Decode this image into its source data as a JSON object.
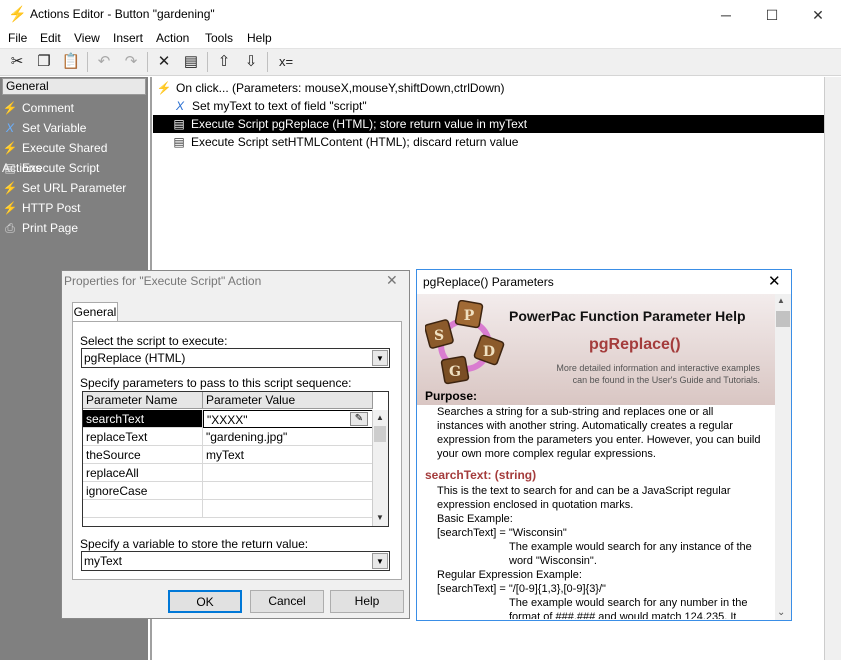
{
  "window": {
    "title": "Actions Editor - Button \"gardening\""
  },
  "menu": [
    "File",
    "Edit",
    "View",
    "Insert",
    "Action",
    "Tools",
    "Help"
  ],
  "left": {
    "header": "General",
    "items": [
      "Comment",
      "Set Variable",
      "Execute Shared Actions",
      "Execute Script",
      "Set URL Parameter",
      "HTTP Post",
      "Print Page"
    ]
  },
  "actions": [
    "On click... (Parameters: mouseX,mouseY,shiftDown,ctrlDown)",
    "Set myText to text of field \"script\"",
    "Execute Script pgReplace (HTML); store return value in myText",
    "Execute Script setHTMLContent (HTML); discard return value"
  ],
  "props": {
    "title": "Properties for \"Execute Script\" Action",
    "tab": "General",
    "select_label": "Select the script to execute:",
    "script": "pgReplace (HTML)",
    "params_label": "Specify parameters to pass to this script sequence:",
    "col_name": "Parameter Name",
    "col_value": "Parameter Value",
    "rows": [
      {
        "name": "searchText",
        "value": "\"XXXX\""
      },
      {
        "name": "replaceText",
        "value": "\"gardening.jpg\""
      },
      {
        "name": "theSource",
        "value": "myText"
      },
      {
        "name": "replaceAll",
        "value": ""
      },
      {
        "name": "ignoreCase",
        "value": ""
      }
    ],
    "var_label": "Specify a variable to store the return value:",
    "var": "myText",
    "ok": "OK",
    "cancel": "Cancel",
    "help": "Help"
  },
  "help": {
    "title": "pgReplace() Parameters",
    "heading": "PowerPac Function Parameter Help",
    "func": "pgReplace()",
    "note1": "More detailed information and interactive examples",
    "note2": "can be found in the User's Guide and Tutorials.",
    "purpose_h": "Purpose:",
    "purpose1": "Searches a string for a sub-string and replaces one or all",
    "purpose2": "instances with another string. Automatically creates a regular",
    "purpose3": "expression from the parameters you enter. However, you can build",
    "purpose4": "your own more complex regular expressions.",
    "search_h": "searchText: (string)",
    "s1": "This is the text to search for and can be a JavaScript regular",
    "s2": "expression enclosed in quotation marks.",
    "s3": "Basic Example:",
    "s4": "[searchText] = \"Wisconsin\"",
    "s5": "The example would search for any instance of the",
    "s6": "word \"Wisconsin\".",
    "s7": "Regular Expression Example:",
    "s8": "[searchText] = \"/[0-9]{1,3},[0-9]{3}/\"",
    "s9": "The example would search for any number in the",
    "s10": "format of ###,### and would match 124,235. It"
  }
}
